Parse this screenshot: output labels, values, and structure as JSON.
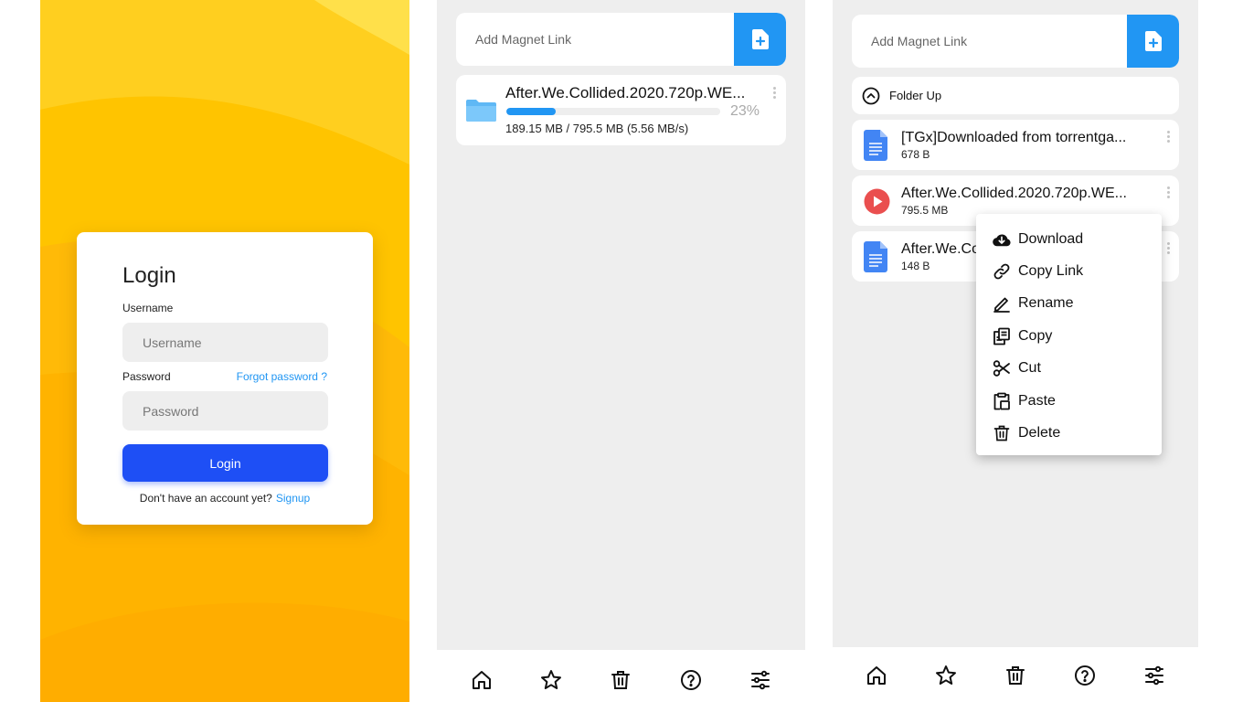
{
  "login": {
    "title": "Login",
    "username_label": "Username",
    "username_placeholder": "Username",
    "password_label": "Password",
    "password_placeholder": "Password",
    "forgot_link": "Forgot password ?",
    "login_button": "Login",
    "no_account_text": "Don't have an account yet?",
    "signup_link": "Signup",
    "colors": {
      "background": "#ffc107",
      "button": "#1e4ff5",
      "link": "#2196f3"
    }
  },
  "downloads": {
    "magnet_placeholder": "Add Magnet Link",
    "add_button_icon": "file-plus-icon",
    "item": {
      "icon": "folder-icon",
      "name": "After.We.Collided.2020.720p.WE...",
      "progress_percent": 23,
      "progress_label": "23%",
      "size_text": "189.15 MB / 795.5 MB (5.56 MB/s)"
    },
    "accent": "#2196f3"
  },
  "files": {
    "magnet_placeholder": "Add Magnet Link",
    "folder_up_label": "Folder Up",
    "items": [
      {
        "icon": "document-icon",
        "name": "[TGx]Downloaded from torrentga...",
        "size": "678 B"
      },
      {
        "icon": "video-play-icon",
        "name": "After.We.Collided.2020.720p.WE...",
        "size": "795.5 MB"
      },
      {
        "icon": "document-icon",
        "name": "After.We.Co",
        "size": "148 B"
      }
    ],
    "context_menu": [
      {
        "icon": "cloud-download-icon",
        "label": "Download"
      },
      {
        "icon": "link-icon",
        "label": "Copy Link"
      },
      {
        "icon": "pencil-icon",
        "label": "Rename"
      },
      {
        "icon": "copy-icon",
        "label": "Copy"
      },
      {
        "icon": "scissors-icon",
        "label": "Cut"
      },
      {
        "icon": "paste-icon",
        "label": "Paste"
      },
      {
        "icon": "trash-icon",
        "label": "Delete"
      }
    ]
  },
  "bottom_nav": [
    {
      "icon": "home-icon"
    },
    {
      "icon": "star-icon"
    },
    {
      "icon": "trash-icon"
    },
    {
      "icon": "help-circle-icon"
    },
    {
      "icon": "sliders-icon"
    }
  ]
}
